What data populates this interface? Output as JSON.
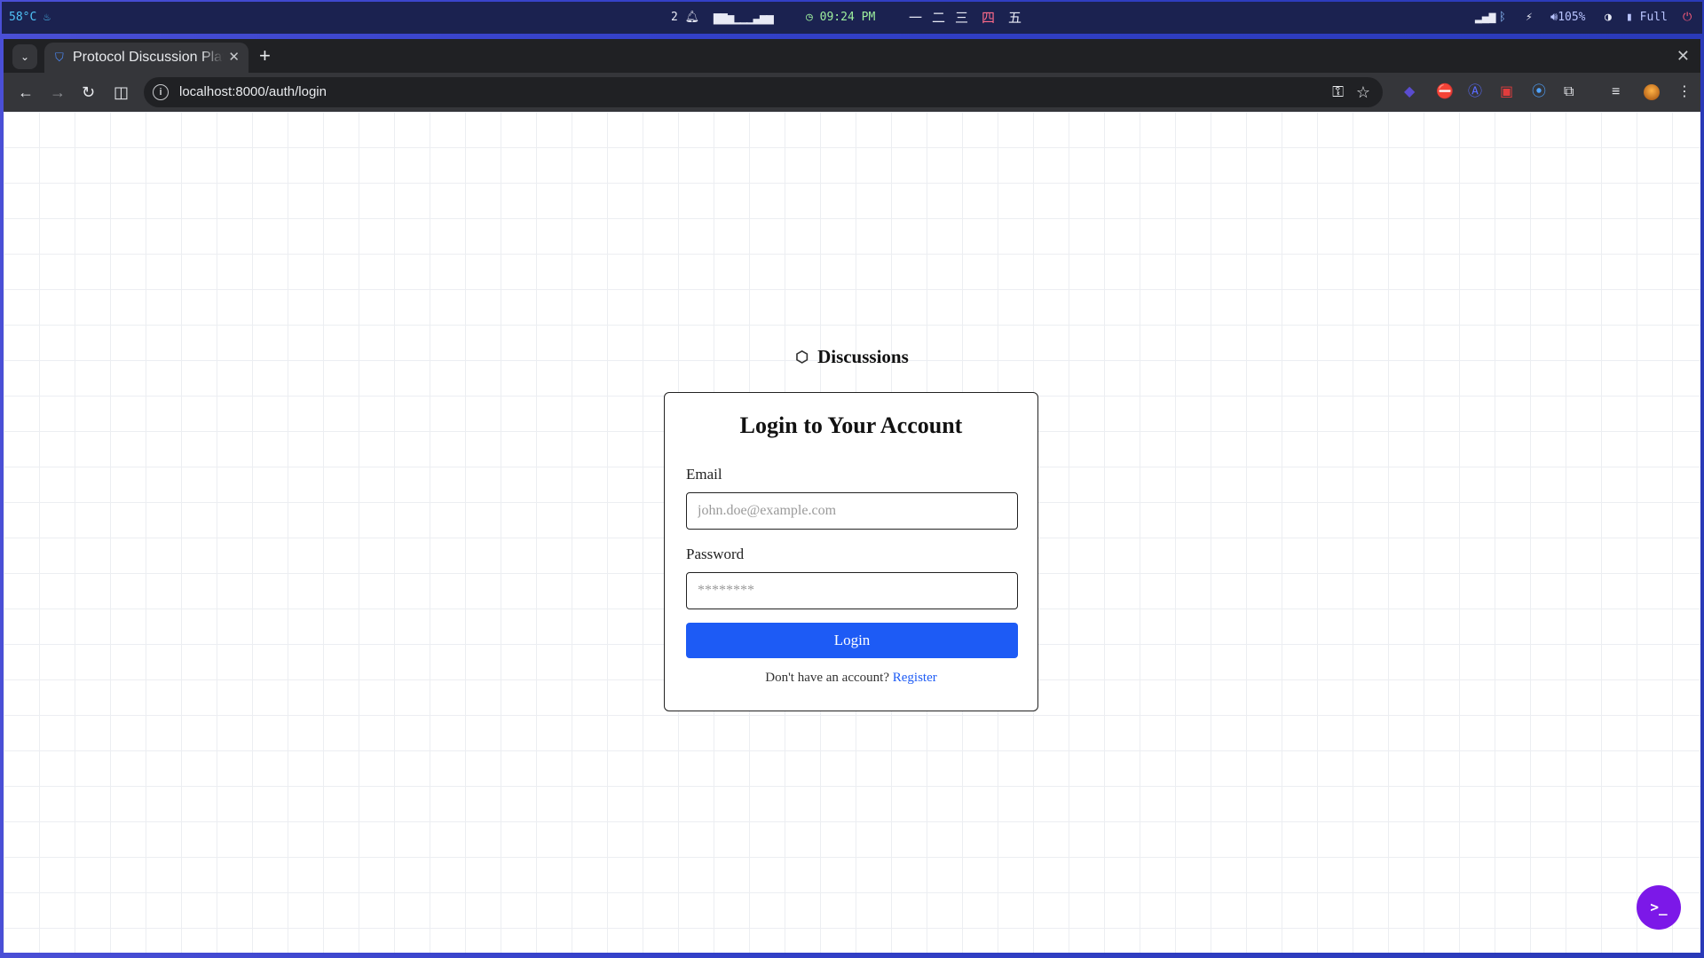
{
  "system_bar": {
    "temperature": "58°C",
    "temp_icon": "flame-icon",
    "notifications": "2",
    "workload_bars": "▆▆▅▁▁▁▃▅▅",
    "clock": "09:24 PM",
    "workspaces": [
      "一",
      "二",
      "三",
      "四",
      "五"
    ],
    "volume": "105%",
    "battery": "Full"
  },
  "browser": {
    "tab_title": "Protocol Discussion Platform",
    "url": "localhost:8000/auth/login"
  },
  "page": {
    "brand": "Discussions",
    "login_title": "Login to Your Account",
    "email_label": "Email",
    "email_placeholder": "john.doe@example.com",
    "password_label": "Password",
    "password_placeholder": "********",
    "login_button": "Login",
    "register_prompt": "Don't have an account?",
    "register_link": "Register",
    "fab_symbol": ">_"
  },
  "colors": {
    "primary": "#1d5bf5",
    "fab": "#7c18e8"
  }
}
